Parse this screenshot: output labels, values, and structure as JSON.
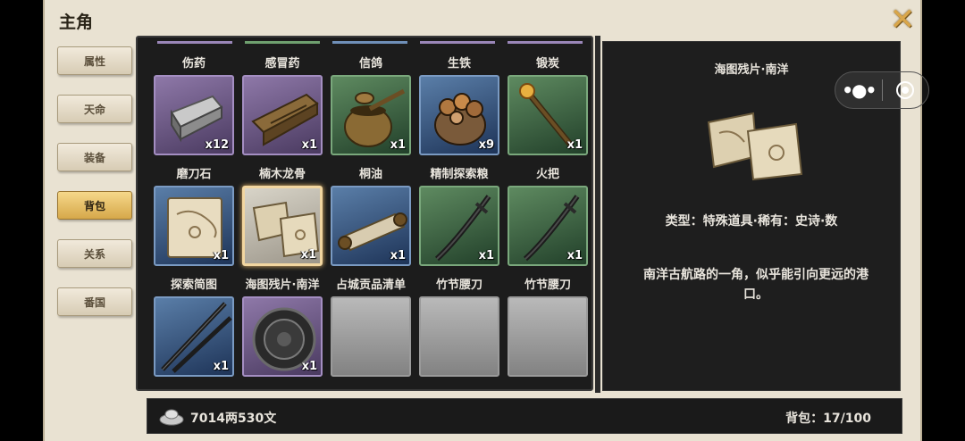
{
  "header": {
    "title": "主角",
    "close_icon": "close-x-icon"
  },
  "tabs": [
    {
      "label": "属性",
      "active": false
    },
    {
      "label": "天命",
      "active": false
    },
    {
      "label": "装备",
      "active": false
    },
    {
      "label": "背包",
      "active": true
    },
    {
      "label": "关系",
      "active": false
    },
    {
      "label": "番国",
      "active": false
    }
  ],
  "inventory": {
    "items": [
      {
        "name": "伤药",
        "qty": "x12",
        "rarity": "purple",
        "icon": "whetstone-icon"
      },
      {
        "name": "感冒药",
        "qty": "x1",
        "rarity": "purple",
        "icon": "wood-beam-icon"
      },
      {
        "name": "信鸽",
        "qty": "x1",
        "rarity": "green",
        "icon": "oil-pot-icon"
      },
      {
        "name": "生铁",
        "qty": "x9",
        "rarity": "blue",
        "icon": "food-bundle-icon"
      },
      {
        "name": "锻炭",
        "qty": "x1",
        "rarity": "green",
        "icon": "torch-icon"
      },
      {
        "name": "磨刀石",
        "qty": "x1",
        "rarity": "blue",
        "icon": "treasure-map-icon"
      },
      {
        "name": "楠木龙骨",
        "qty": "x1",
        "rarity": "selected",
        "icon": "map-fragment-icon"
      },
      {
        "name": "桐油",
        "qty": "x1",
        "rarity": "blue",
        "icon": "scroll-icon"
      },
      {
        "name": "精制探索粮",
        "qty": "x1",
        "rarity": "green",
        "icon": "saber-icon"
      },
      {
        "name": "火把",
        "qty": "x1",
        "rarity": "green",
        "icon": "saber-icon"
      },
      {
        "name": "探索简图",
        "qty": "x1",
        "rarity": "blue",
        "icon": "katana-icon"
      },
      {
        "name": "海图残片·南洋",
        "qty": "x1",
        "rarity": "purple",
        "icon": "shield-icon"
      },
      {
        "name": "占城贡品清单",
        "qty": "",
        "rarity": "empty",
        "icon": ""
      },
      {
        "name": "竹节腰刀",
        "qty": "",
        "rarity": "empty",
        "icon": ""
      },
      {
        "name": "竹节腰刀",
        "qty": "",
        "rarity": "empty",
        "icon": ""
      }
    ]
  },
  "detail": {
    "name": "海图残片·南洋",
    "icon": "map-fragment-icon",
    "type_line": "类型：特殊道具·稀有：史诗·数",
    "description": "南洋古航路的一角，似乎能引向更远的港口。"
  },
  "capsule": {
    "more_icon": "more-dots-icon",
    "close_icon": "target-circle-icon"
  },
  "footer": {
    "money": "7014两530文",
    "money_icon": "silver-ingot-icon",
    "bag": "背包：17/100"
  },
  "colors": {
    "purple": "#8e78a8",
    "green": "#5e8a60",
    "blue": "#5a7ea8",
    "active_tab": "#e0b45c",
    "bg": "#e9e2d2"
  }
}
